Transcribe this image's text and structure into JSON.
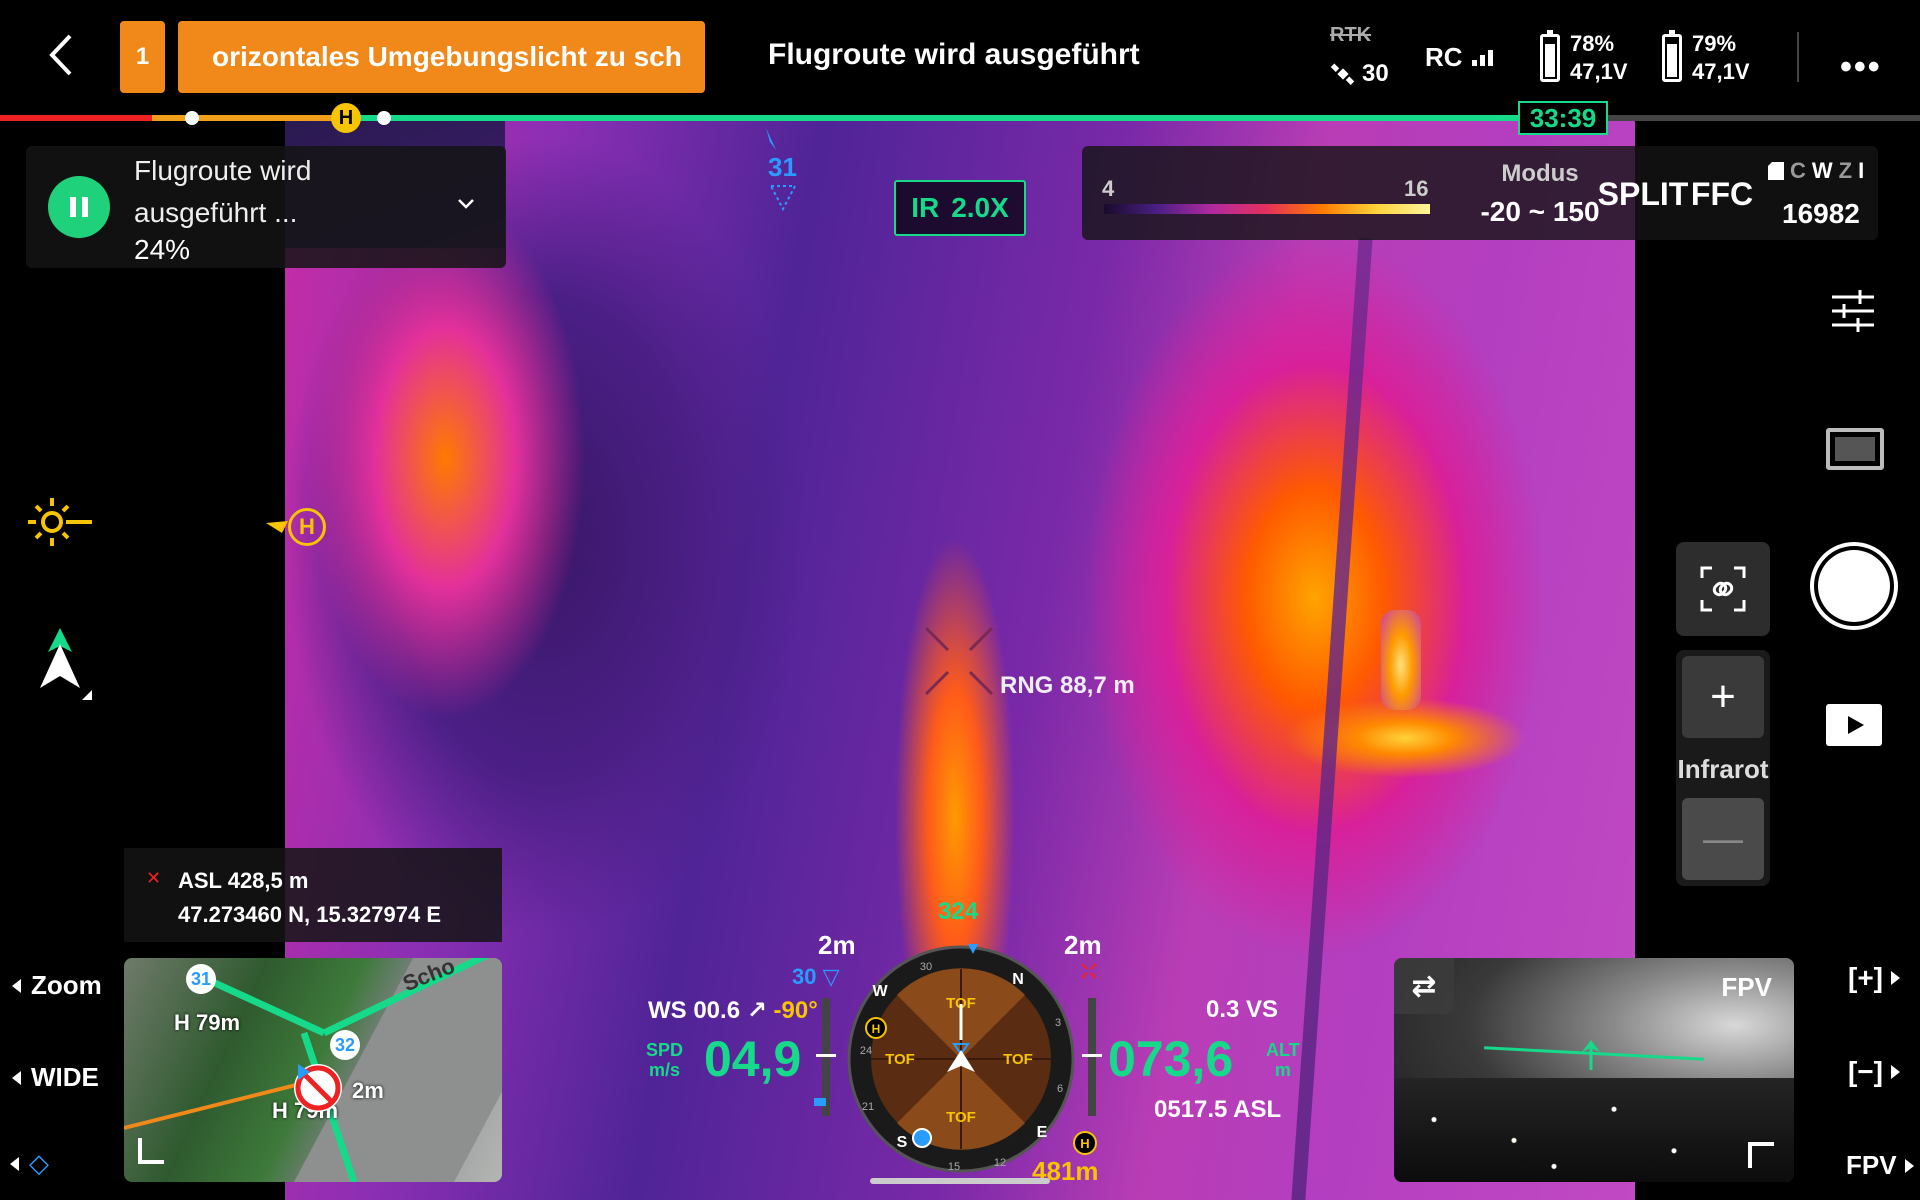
{
  "header": {
    "step_number": "1",
    "warning_text": "orizontales Umgebungslicht zu sch",
    "status_title": "Flugroute wird ausgeführt",
    "rtk_label": "RTK",
    "satellite_count": "30",
    "rc_label": "RC",
    "battery_1": {
      "percent": "78%",
      "voltage": "47,1V",
      "level": 0.78
    },
    "battery_2": {
      "percent": "79%",
      "voltage": "47,1V",
      "level": 0.79
    },
    "more_label": "•••"
  },
  "route": {
    "timer": "33:39",
    "home_label": "H"
  },
  "flight_panel": {
    "status_text": "Flugroute wird ausgeführt ...",
    "progress": "24%"
  },
  "waypoint_top": "31",
  "ir_zoom": {
    "mode": "IR",
    "level": "2.0X"
  },
  "palette": {
    "min": "4",
    "max": "16",
    "modus_label": "Modus",
    "modus_range": "-20 ~ 150",
    "split_label": "SPLIT",
    "ffc_label": "FFC",
    "storage_letters": [
      "C",
      "W",
      "Z",
      "I"
    ],
    "storage_count": "16982"
  },
  "right": {
    "zoom_label": "Infrarot",
    "plus": "+",
    "minus": "—"
  },
  "home_marker_left": "H",
  "target": {
    "range": "RNG 88,7 m"
  },
  "position": {
    "asl": "ASL 428,5 m",
    "coords": "47.273460 N, 15.327974 E"
  },
  "left_side": {
    "zoom": "Zoom",
    "wide": "WIDE"
  },
  "minimap": {
    "wp31": "31",
    "wp32": "32",
    "h79": "H 79m",
    "h79b": "H 79m",
    "dist": "2m",
    "street": "Scho"
  },
  "hud": {
    "ws": "WS 00.6",
    "wind_dir": "↗",
    "gimbal": "-90°",
    "spd_unit_1": "SPD",
    "spd_unit_2": "m/s",
    "speed": "04,9",
    "altitude": "073,6",
    "alt_unit_1": "ALT",
    "alt_unit_2": "m",
    "vs": "0.3 VS",
    "asl": "0517.5 ASL",
    "dist_left": "2m",
    "dist_right": "2m",
    "wp30": "30",
    "heading": "324",
    "home_dist": "481m",
    "compass": {
      "N": "N",
      "E": "E",
      "S": "S",
      "W": "W",
      "ticks": [
        "30",
        "3",
        "6",
        "12",
        "15",
        "21",
        "24"
      ],
      "tof": "TOF"
    }
  },
  "fpv": {
    "label": "FPV",
    "swap": "⇄",
    "side_plus": "[+]",
    "side_minus": "[−]",
    "side_fpv": "FPV"
  },
  "colors": {
    "accent_green": "#16d98a",
    "warning_orange": "#f0891a",
    "home_yellow": "#f7c400",
    "waypoint_blue": "#2a9cff"
  }
}
